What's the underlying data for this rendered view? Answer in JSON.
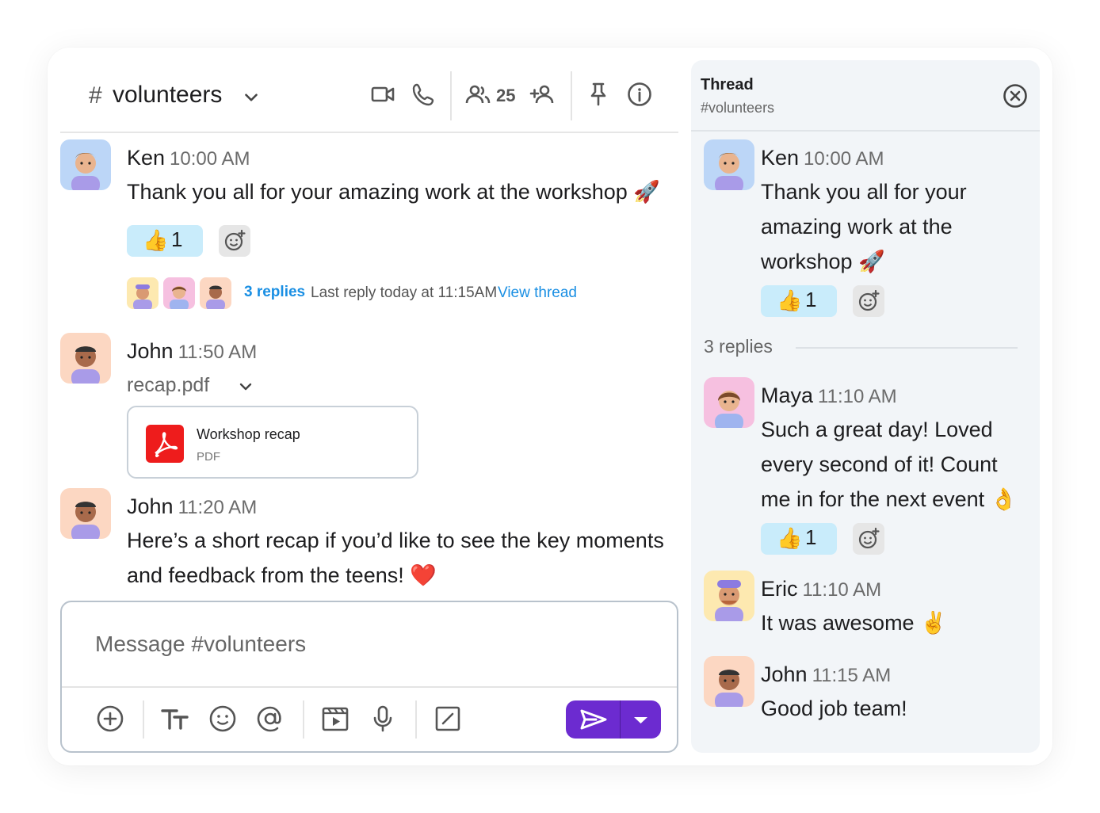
{
  "channel": {
    "hash": "#",
    "name": "volunteers",
    "member_count": "25"
  },
  "messages": [
    {
      "author": "Ken",
      "time": "10:00 AM",
      "text": "Thank you all for your amazing work at the workshop 🚀",
      "reaction": {
        "emoji": "👍",
        "count": "1"
      },
      "thread_summary": {
        "replies": "3 replies",
        "last_reply": "Last reply today at 11:15AM",
        "view": "View thread"
      }
    },
    {
      "author": "John",
      "time": "11:50 AM",
      "file_label": "recap.pdf",
      "file": {
        "title": "Workshop recap",
        "type": "PDF"
      }
    },
    {
      "author": "John",
      "time": "11:20 AM",
      "text": "Here’s a short recap if you’d like to see the key moments and feedback from the teens! ❤️"
    }
  ],
  "composer": {
    "placeholder": "Message #volunteers"
  },
  "thread": {
    "title": "Thread",
    "channel": "#volunteers",
    "parent": {
      "author": "Ken",
      "time": "10:00 AM",
      "text": "Thank you all for your amazing work at the workshop 🚀",
      "reaction": {
        "emoji": "👍",
        "count": "1"
      }
    },
    "replies_label": "3 replies",
    "replies": [
      {
        "author": "Maya",
        "time": "11:10 AM",
        "text": "Such a great day! Loved every second of it! Count me in for the next event 👌",
        "reaction": {
          "emoji": "👍",
          "count": "1"
        }
      },
      {
        "author": "Eric",
        "time": "11:10 AM",
        "text": "It was awesome ✌️"
      },
      {
        "author": "John",
        "time": "11:15 AM",
        "text": "Good job team!"
      }
    ]
  },
  "colors": {
    "accent": "#6c2bd0",
    "link": "#1a8fe3",
    "reaction_bg": "#c9ecfb",
    "thread_bg": "#f2f5f8",
    "pdf_red": "#ee1c1c"
  }
}
